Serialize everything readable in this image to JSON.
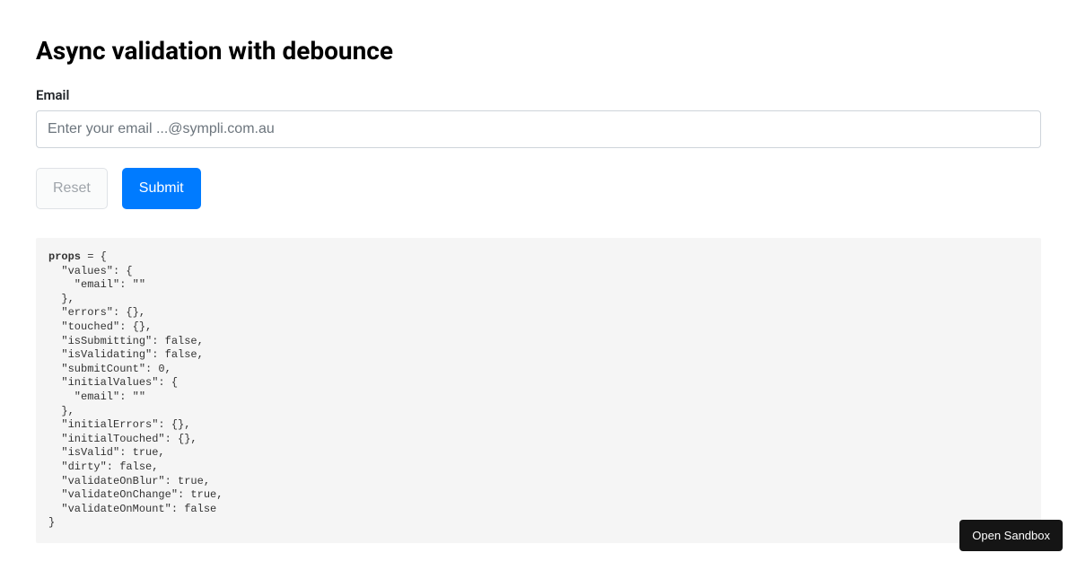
{
  "page": {
    "title": "Async validation with debounce"
  },
  "form": {
    "email_label": "Email",
    "email_placeholder": "Enter your email ...@sympli.com.au",
    "email_value": "",
    "reset_label": "Reset",
    "submit_label": "Submit"
  },
  "code": {
    "prefix": "props",
    "body": " = {\n  \"values\": {\n    \"email\": \"\"\n  },\n  \"errors\": {},\n  \"touched\": {},\n  \"isSubmitting\": false,\n  \"isValidating\": false,\n  \"submitCount\": 0,\n  \"initialValues\": {\n    \"email\": \"\"\n  },\n  \"initialErrors\": {},\n  \"initialTouched\": {},\n  \"isValid\": true,\n  \"dirty\": false,\n  \"validateOnBlur\": true,\n  \"validateOnChange\": true,\n  \"validateOnMount\": false\n}"
  },
  "sandbox": {
    "open_label": "Open Sandbox"
  }
}
